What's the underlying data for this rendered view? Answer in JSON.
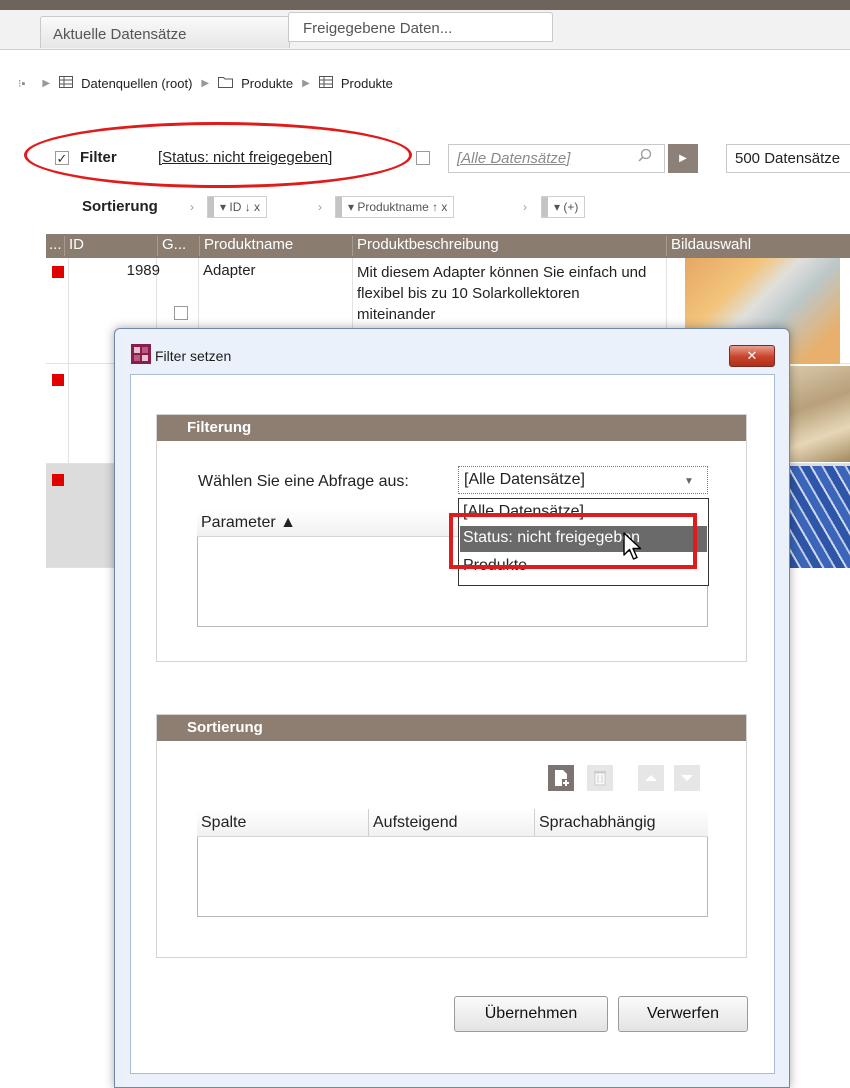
{
  "tabs": [
    {
      "label": "Aktuelle Datensätze"
    },
    {
      "label": "Freigegebene Daten..."
    }
  ],
  "breadcrumb": {
    "items": [
      "Datenquellen (root)",
      "Produkte",
      "Produkte"
    ]
  },
  "filter": {
    "checkbox_mark": "✓",
    "label": "Filter",
    "value": "[Status: nicht freigegeben]",
    "search_placeholder": "[Alle Datensätze]",
    "count": "500 Datensätze"
  },
  "sorting": {
    "label": "Sortierung",
    "chips": [
      "ID  ↓ x",
      "Produktname  ↑ x",
      "(+)"
    ]
  },
  "grid": {
    "columns": [
      "...",
      "ID",
      "G...",
      "Produktname",
      "Produktbeschreibung",
      "Bildauswahl"
    ],
    "rows": [
      {
        "id": "1989",
        "name": "Adapter",
        "description": "Mit diesem Adapter können Sie einfach und flexibel bis zu 10 Solarkollektoren miteinander"
      },
      {
        "id": "",
        "name": "",
        "description": ""
      },
      {
        "id": "",
        "name": "",
        "description": ""
      }
    ]
  },
  "dialog": {
    "title": "Filter setzen",
    "close": "✕",
    "filter_panel": {
      "header": "Filterung",
      "query_label": "Wählen Sie eine Abfrage aus:",
      "query_value": "[Alle Datensätze]",
      "param_header": "Parameter  ▲",
      "options": [
        "[Alle Datensätze]",
        "Status: nicht freigegeben",
        "Produkte"
      ]
    },
    "sort_panel": {
      "header": "Sortierung",
      "columns": [
        "Spalte",
        "Aufsteigend",
        "Sprachabhängig"
      ]
    },
    "apply_label": "Übernehmen",
    "discard_label": "Verwerfen"
  },
  "colors": {
    "accent_brown": "#8b7c70",
    "annotation_red": "#e01b1b",
    "status_red": "#e00000"
  }
}
